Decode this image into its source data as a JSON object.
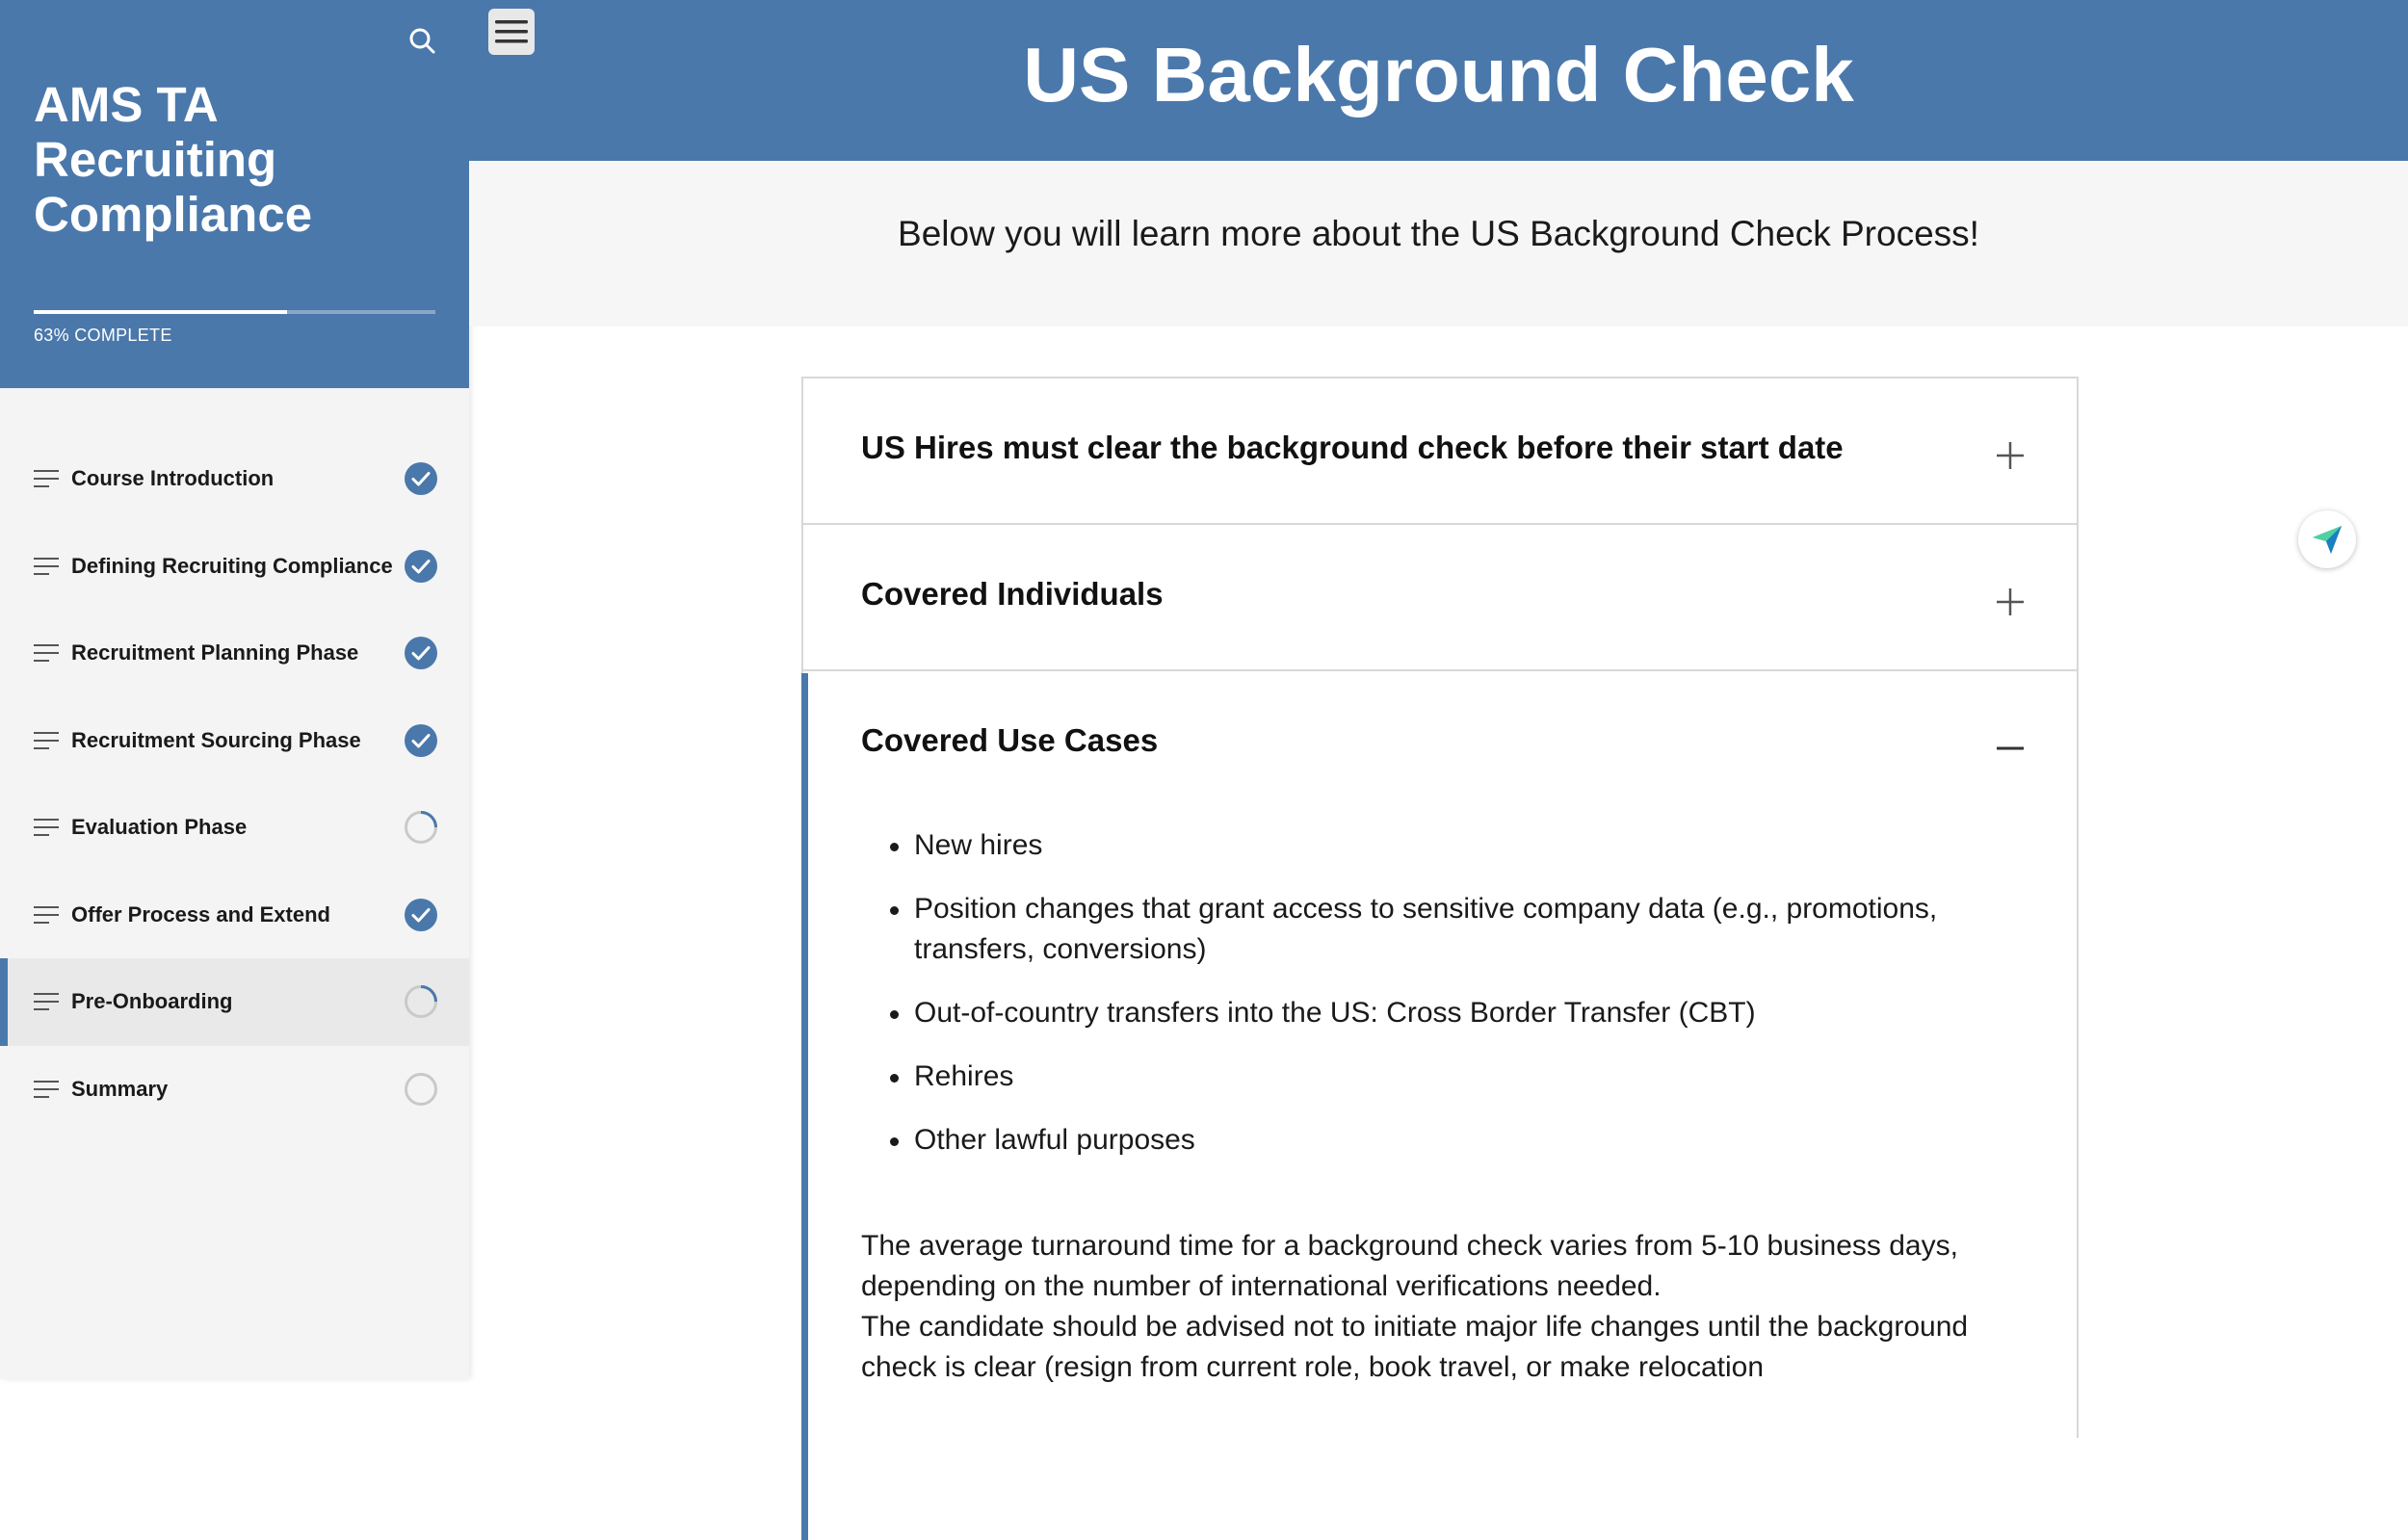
{
  "sidebar": {
    "course_title": "AMS TA Recruiting Compliance",
    "progress_percent": 63,
    "progress_label": "63% COMPLETE",
    "items": [
      {
        "label": "Course Introduction",
        "status": "complete"
      },
      {
        "label": "Defining Recruiting Compliance",
        "status": "complete"
      },
      {
        "label": "Recruitment Planning Phase",
        "status": "complete"
      },
      {
        "label": "Recruitment Sourcing Phase",
        "status": "complete"
      },
      {
        "label": "Evaluation Phase",
        "status": "in-progress"
      },
      {
        "label": "Offer Process and Extend",
        "status": "complete"
      },
      {
        "label": "Pre-Onboarding",
        "status": "in-progress"
      },
      {
        "label": "Summary",
        "status": "not-started"
      }
    ],
    "active_item": "Pre-Onboarding"
  },
  "main": {
    "title": "US Background Check",
    "intro": "Below you will learn more about the US Background Check Process!",
    "accordion": [
      {
        "title": "US Hires must clear the background check before their start date",
        "expanded": false
      },
      {
        "title": "Covered Individuals",
        "expanded": false
      },
      {
        "title": "Covered Use Cases",
        "expanded": true,
        "bullets": [
          "New hires",
          "Position changes that grant access to sensitive company data (e.g., promotions, transfers, conversions)",
          "Out-of-country transfers into the US: Cross Border Transfer (CBT)",
          "Rehires",
          "Other lawful purposes"
        ],
        "paragraph_1": "The average turnaround time for a background check varies from 5-10 business days, depending on the number of international verifications needed.",
        "paragraph_2": "The candidate should be advised not to initiate major life changes until the background check is clear (resign from current role, book travel, or make relocation"
      }
    ]
  },
  "colors": {
    "brand": "#4a78ab",
    "complete": "#4a78ab",
    "sidebar_bg": "#f4f4f4"
  },
  "icons": {
    "search": "search-icon",
    "menu": "hamburger-menu-icon",
    "nav": "lines-icon",
    "complete": "check-circle-icon",
    "in_progress": "partial-circle-icon",
    "not_started": "empty-circle-icon",
    "expand": "plus-icon",
    "collapse": "minus-icon",
    "send": "paper-plane-icon"
  }
}
